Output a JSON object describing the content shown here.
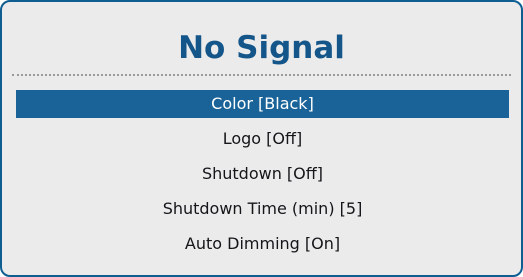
{
  "osd": {
    "title": "No Signal",
    "accent_color": "#1a6399",
    "menu": [
      {
        "label": "Color [Black]",
        "selected": true
      },
      {
        "label": "Logo [Off]",
        "selected": false
      },
      {
        "label": "Shutdown [Off]",
        "selected": false
      },
      {
        "label": "Shutdown Time (min) [5]",
        "selected": false
      },
      {
        "label": "Auto Dimming [On]",
        "selected": false
      }
    ]
  }
}
